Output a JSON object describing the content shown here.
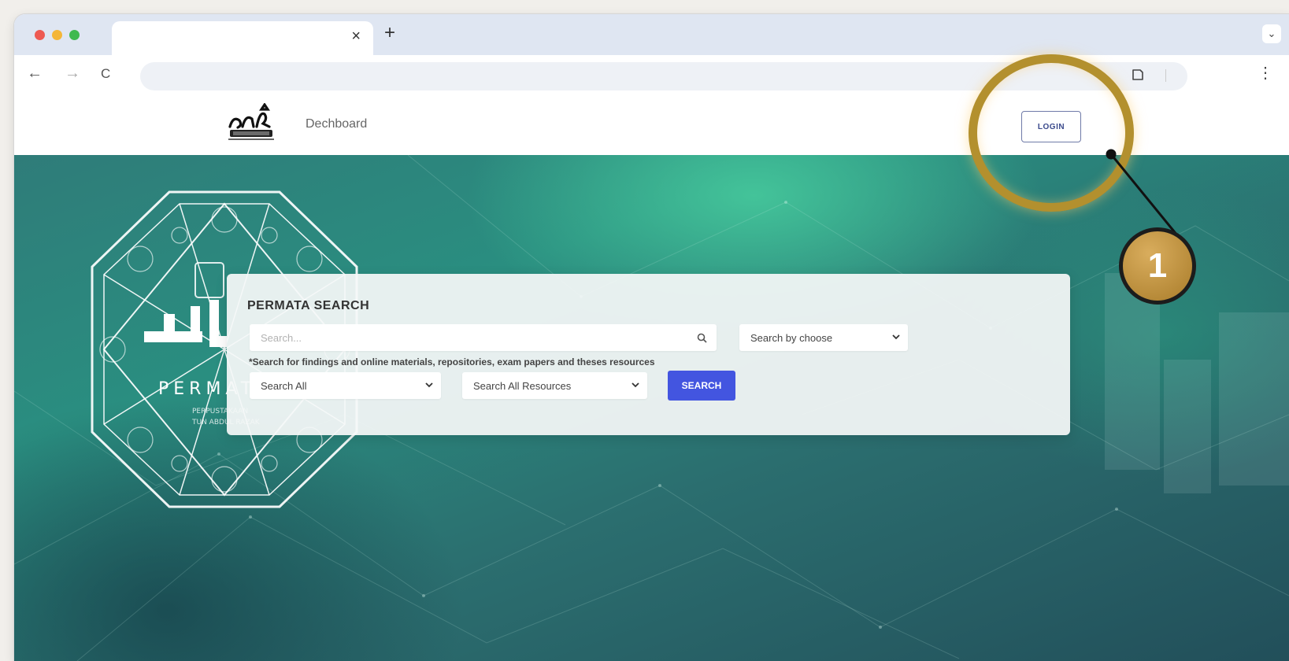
{
  "browser": {
    "tab_close_glyph": "×",
    "new_tab_glyph": "+",
    "tab_menu_glyph": "⌄",
    "back_glyph": "←",
    "forward_glyph": "→",
    "reload_glyph": "C",
    "menu_glyph": "⋮",
    "traffic_lights": [
      "#ee5a52",
      "#f4b638",
      "#3fb950"
    ]
  },
  "header": {
    "logo_icon": "permata-logo-icon",
    "nav_dashboard": "Dechboard",
    "login_label": "LOGIN"
  },
  "search": {
    "title": "PERMATA SEARCH",
    "input_placeholder": "Search...",
    "scope_select_value": "Search by choose",
    "hint": "*Search for findings and online materials, repositories, exam papers and theses resources",
    "select1_value": "Search All",
    "select2_value": "Search All Resources",
    "button_label": "SEARCH"
  },
  "emblem": {
    "letters": "PERMATA",
    "sub1": "PERPUSTAKAAN",
    "sub2": "TUN ABDUL RAZAK"
  },
  "annotation": {
    "number": "1"
  },
  "colors": {
    "accent_button": "#4355e0",
    "callout_gold": "#b3902e",
    "hero_teal": "#2a8e80"
  }
}
